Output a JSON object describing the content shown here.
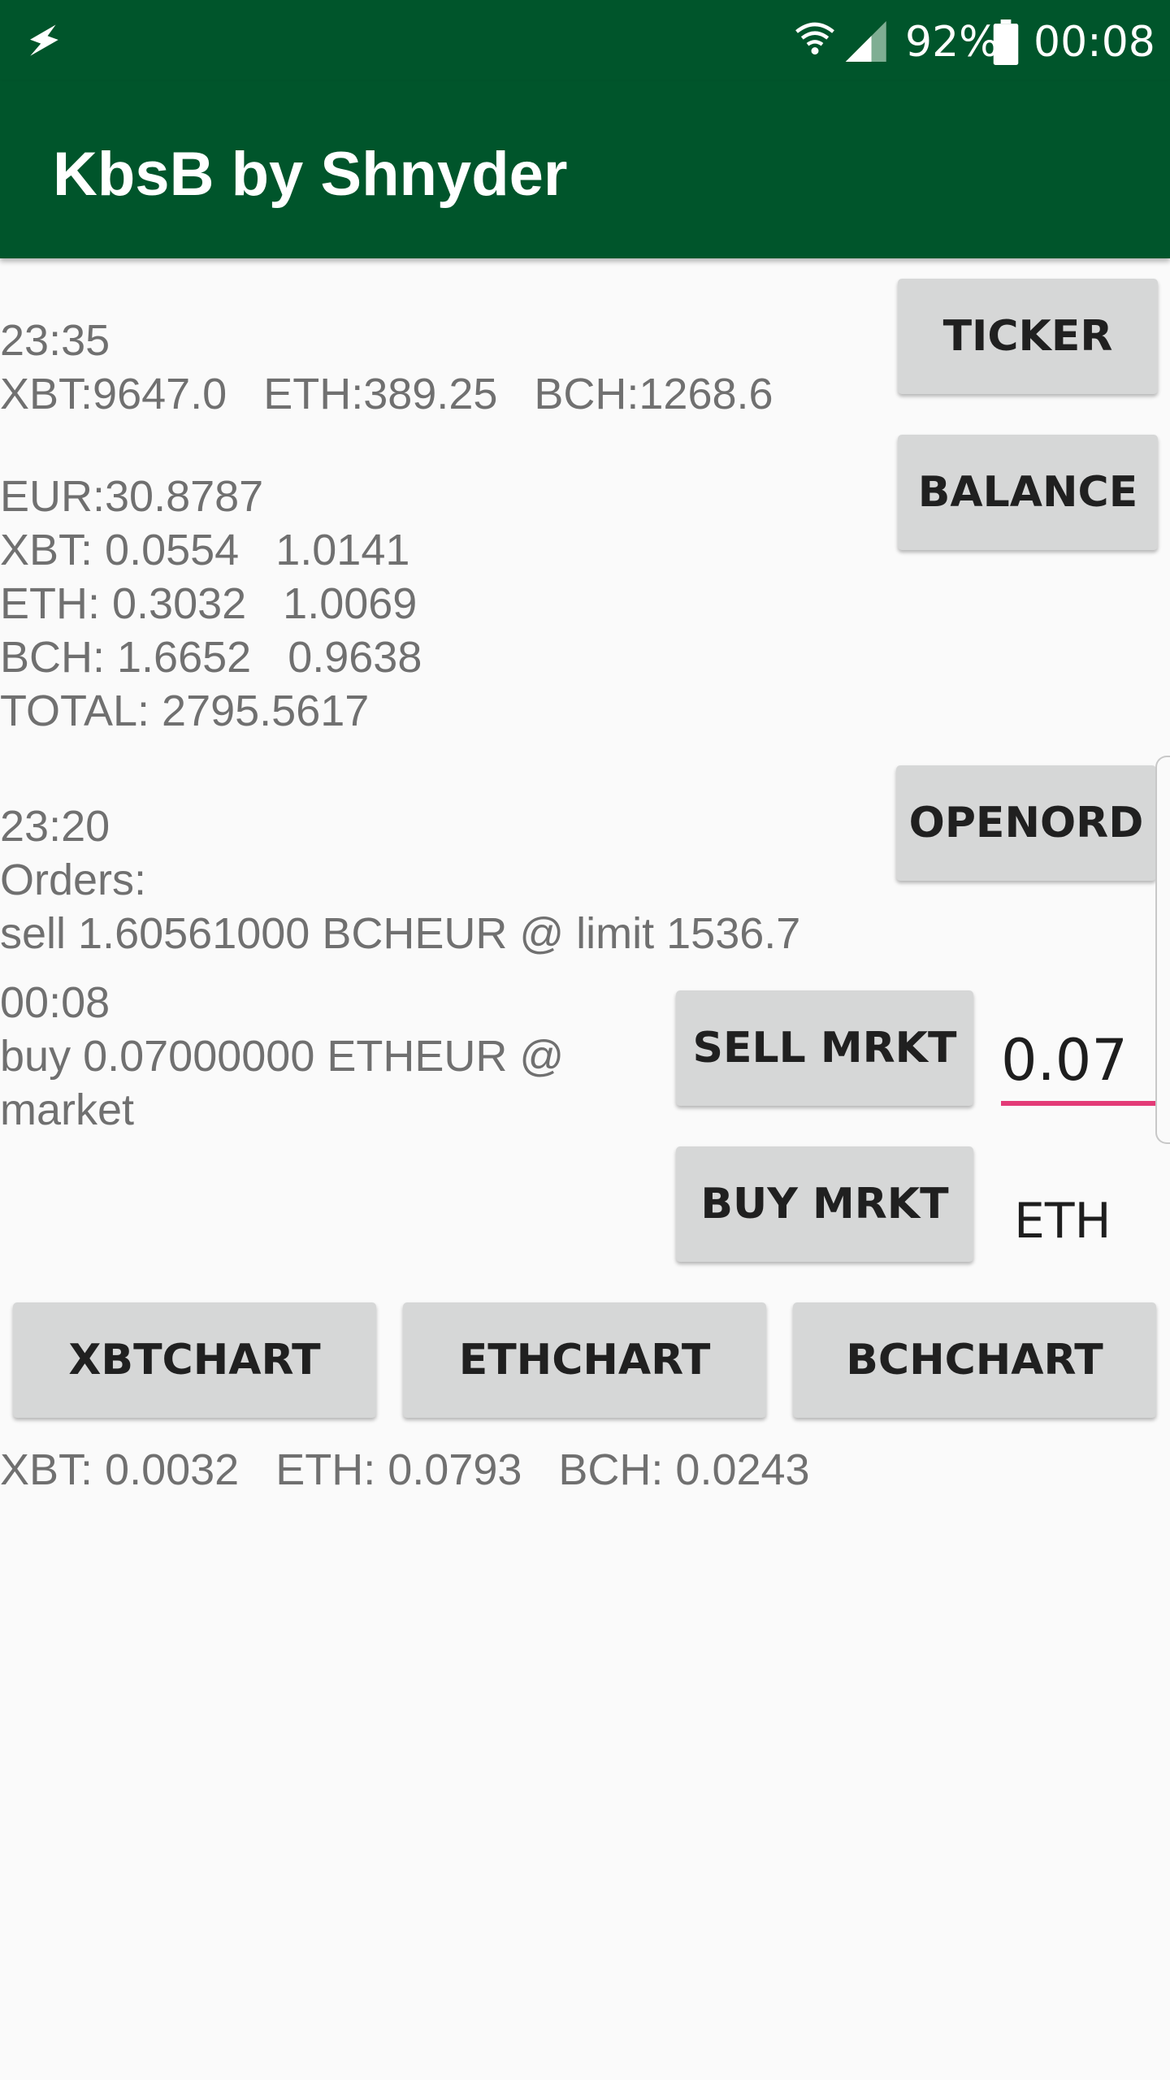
{
  "status_bar": {
    "battery": "92%",
    "time": "00:08",
    "icons": [
      "flash-icon",
      "wifi-icon",
      "signal-icon",
      "battery-icon"
    ]
  },
  "app_bar": {
    "title": "KbsB by Shnyder"
  },
  "ticker": {
    "time": "23:35",
    "prices": "XBT:9647.0   ETH:389.25   BCH:1268.6",
    "button": "TICKER"
  },
  "balance": {
    "eur": "EUR:30.8787",
    "xbt": "XBT: 0.0554   1.0141",
    "eth": "ETH: 0.3032   1.0069",
    "bch": "BCH: 1.6652   0.9638",
    "total": "TOTAL: 2795.5617",
    "button": "BALANCE"
  },
  "orders": {
    "time": "23:20",
    "label": "Orders:",
    "line": "sell 1.60561000 BCHEUR @ limit 1536.7",
    "button": "OPENORD"
  },
  "last_trade": {
    "time": "00:08",
    "line1": "buy 0.07000000 ETHEUR @",
    "line2": "market"
  },
  "trade": {
    "sell_button": "SELL MRKT",
    "buy_button": "BUY MRKT",
    "quantity": "0.07",
    "unit": "ETH"
  },
  "charts": {
    "xbt_button": "XBTCHART",
    "eth_button": "ETHCHART",
    "bch_button": "BCHCHART"
  },
  "summary": "XBT: 0.0032   ETH: 0.0793   BCH: 0.0243",
  "colors": {
    "primary_dark": "#00552b",
    "accent": "#e33b77",
    "button_bg": "#d6d7d7",
    "text_secondary": "#707070"
  }
}
